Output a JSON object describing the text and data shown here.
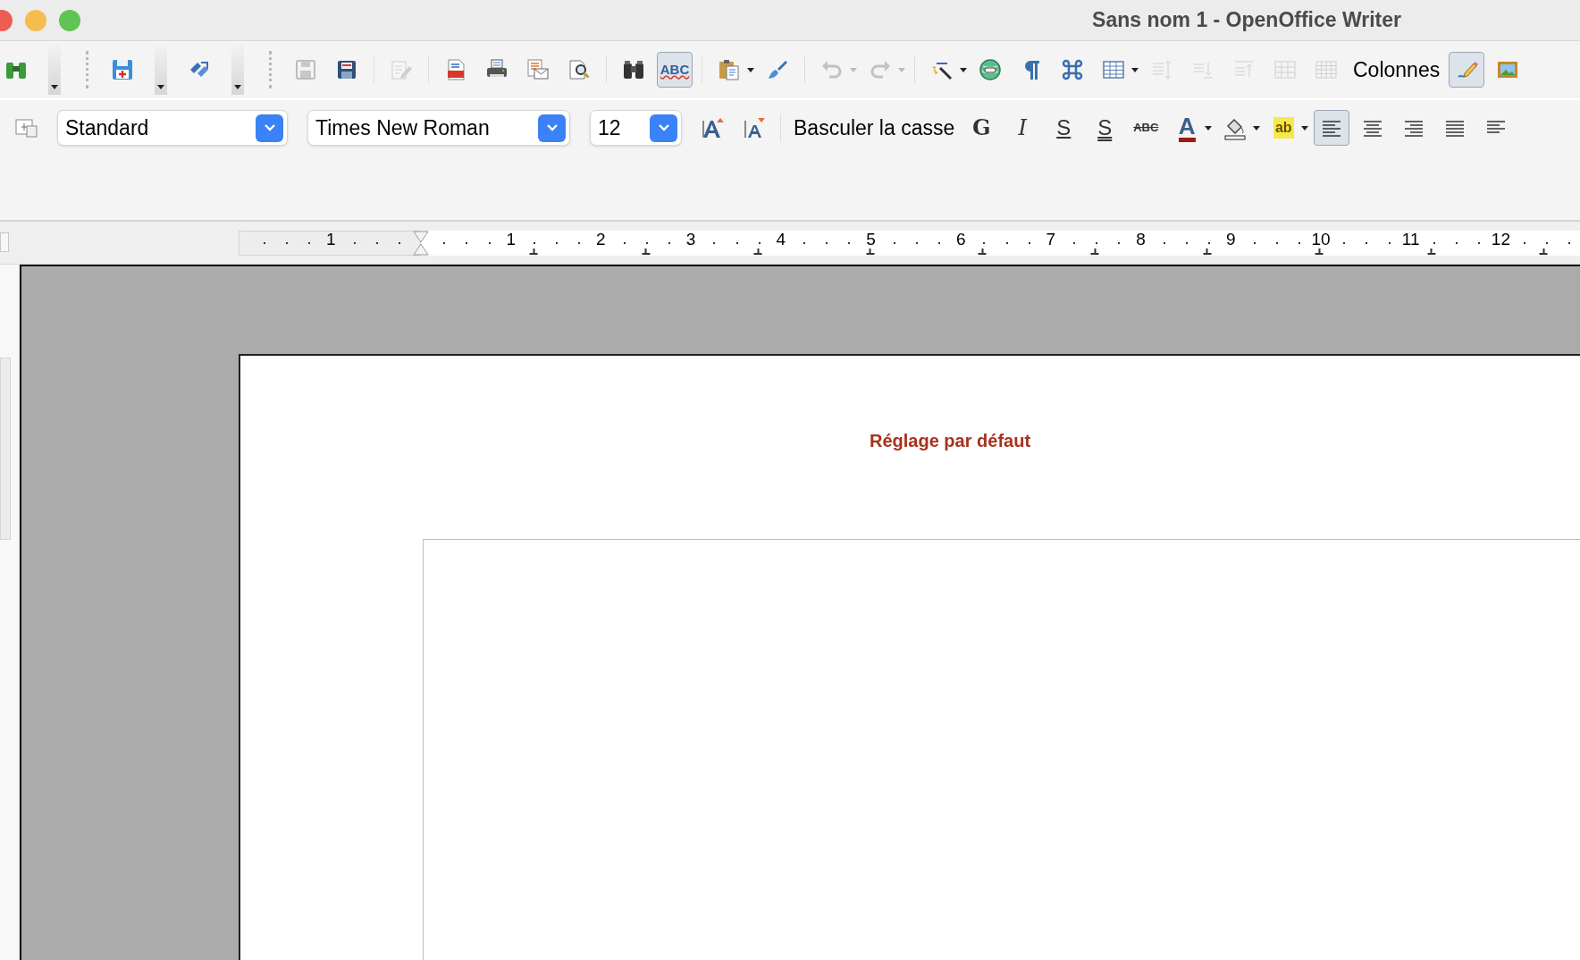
{
  "window": {
    "title": "Sans nom 1 - OpenOffice Writer"
  },
  "standard_toolbar": [
    {
      "kind": "icon",
      "disabled": false,
      "pressed": false
    },
    {
      "kind": "bar-caret"
    },
    {
      "kind": "grip"
    },
    {
      "kind": "icon",
      "disabled": false,
      "pressed": false
    },
    {
      "kind": "bar-caret"
    },
    {
      "kind": "icon",
      "disabled": false,
      "pressed": false
    },
    {
      "kind": "bar-caret"
    },
    {
      "kind": "grip"
    },
    {
      "kind": "icon",
      "disabled": true,
      "pressed": false
    },
    {
      "kind": "icon",
      "disabled": false,
      "pressed": false
    },
    {
      "kind": "separator"
    },
    {
      "kind": "icon",
      "disabled": true,
      "pressed": false
    },
    {
      "kind": "separator"
    },
    {
      "kind": "icon",
      "disabled": false,
      "pressed": false
    },
    {
      "kind": "icon",
      "disabled": false,
      "pressed": false
    },
    {
      "kind": "icon",
      "disabled": false,
      "pressed": false
    },
    {
      "kind": "icon",
      "disabled": false,
      "pressed": false
    },
    {
      "kind": "separator"
    },
    {
      "kind": "icon",
      "disabled": false,
      "pressed": false
    },
    {
      "kind": "glyph",
      "label": "ABC",
      "disabled": false,
      "pressed": true
    },
    {
      "kind": "separator"
    },
    {
      "kind": "icon",
      "disabled": false,
      "pressed": false
    },
    {
      "kind": "caret",
      "disabled": false
    },
    {
      "kind": "icon",
      "disabled": false,
      "pressed": false
    },
    {
      "kind": "separator"
    },
    {
      "kind": "icon",
      "disabled": true,
      "pressed": false
    },
    {
      "kind": "caret",
      "disabled": true
    },
    {
      "kind": "icon",
      "disabled": true,
      "pressed": false
    },
    {
      "kind": "caret",
      "disabled": true
    },
    {
      "kind": "separator"
    },
    {
      "kind": "icon",
      "disabled": false,
      "pressed": false
    },
    {
      "kind": "caret",
      "disabled": false
    },
    {
      "kind": "icon",
      "disabled": false,
      "pressed": false
    },
    {
      "kind": "icon",
      "disabled": false,
      "pressed": false
    },
    {
      "kind": "icon",
      "disabled": false,
      "pressed": false
    },
    {
      "kind": "icon",
      "disabled": false,
      "pressed": false
    },
    {
      "kind": "caret",
      "disabled": false
    },
    {
      "kind": "icon",
      "disabled": true,
      "pressed": false
    },
    {
      "kind": "icon",
      "disabled": true,
      "pressed": false
    },
    {
      "kind": "icon",
      "disabled": true,
      "pressed": false
    },
    {
      "kind": "icon",
      "disabled": true,
      "pressed": false
    },
    {
      "kind": "icon",
      "disabled": true,
      "pressed": false
    },
    {
      "kind": "text",
      "label": "Colonnes"
    },
    {
      "kind": "icon",
      "disabled": false,
      "pressed": true
    },
    {
      "kind": "icon",
      "disabled": false,
      "pressed": false
    }
  ],
  "formatting_toolbar": [
    {
      "kind": "icon",
      "disabled": false,
      "pressed": false
    },
    {
      "kind": "combo",
      "value": "Standard"
    },
    {
      "kind": "combo",
      "value": "Times New Roman"
    },
    {
      "kind": "combo",
      "value": "12"
    },
    {
      "kind": "icon",
      "disabled": false,
      "pressed": false
    },
    {
      "kind": "icon",
      "disabled": false,
      "pressed": false
    },
    {
      "kind": "separator"
    },
    {
      "kind": "text",
      "label": "Basculer la casse"
    },
    {
      "kind": "glyph",
      "label": "G",
      "disabled": false,
      "pressed": false
    },
    {
      "kind": "glyph",
      "label": "I",
      "disabled": false,
      "pressed": false
    },
    {
      "kind": "glyph",
      "label": "S",
      "disabled": false,
      "pressed": false
    },
    {
      "kind": "glyph",
      "label": "S",
      "disabled": false,
      "pressed": false
    },
    {
      "kind": "glyph",
      "label": "ABC",
      "disabled": false,
      "pressed": false
    },
    {
      "kind": "glyph",
      "label": "A",
      "disabled": false,
      "pressed": false
    },
    {
      "kind": "caret",
      "disabled": false
    },
    {
      "kind": "icon",
      "disabled": false,
      "pressed": false
    },
    {
      "kind": "caret",
      "disabled": false
    },
    {
      "kind": "glyph",
      "label": "ab",
      "disabled": false,
      "pressed": false
    },
    {
      "kind": "caret",
      "disabled": false
    },
    {
      "kind": "icon",
      "disabled": false,
      "pressed": true
    },
    {
      "kind": "icon",
      "disabled": false,
      "pressed": false
    },
    {
      "kind": "icon",
      "disabled": false,
      "pressed": false
    },
    {
      "kind": "icon",
      "disabled": false,
      "pressed": false
    },
    {
      "kind": "icon",
      "disabled": false,
      "pressed": false
    }
  ],
  "ruler": {
    "labels": [
      "1",
      "1",
      "2",
      "3",
      "4",
      "5",
      "6",
      "7",
      "8",
      "9",
      "10",
      "11",
      "12"
    ]
  },
  "document": {
    "header": "Réglage par défaut"
  }
}
